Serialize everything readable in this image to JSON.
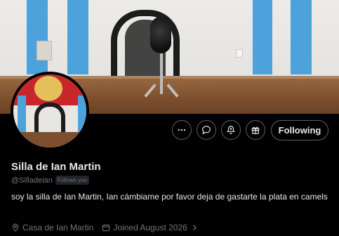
{
  "profile": {
    "name": "Silla de Ian Martin",
    "handle": "@Silladeian",
    "follows_you_badge": "Follows you",
    "bio": "soy la silla de Ian Martin, Ian cámbiame por favor deja de gastarte la plata en camels",
    "location": "Casa de Ian Martin",
    "joined": "Joined August 2026"
  },
  "actions": {
    "more_icon": "more-horizontal-icon",
    "message_icon": "message-bubble-icon",
    "notifications_icon": "bell-plus-icon",
    "subscribe_icon": "gift-icon",
    "follow_label": "Following"
  },
  "colors": {
    "background": "#000000",
    "primary_text": "#e7e9ea",
    "secondary_text": "#71767b",
    "button_border": "#536471",
    "banner_stripe_blue": "#4ea2dc"
  }
}
